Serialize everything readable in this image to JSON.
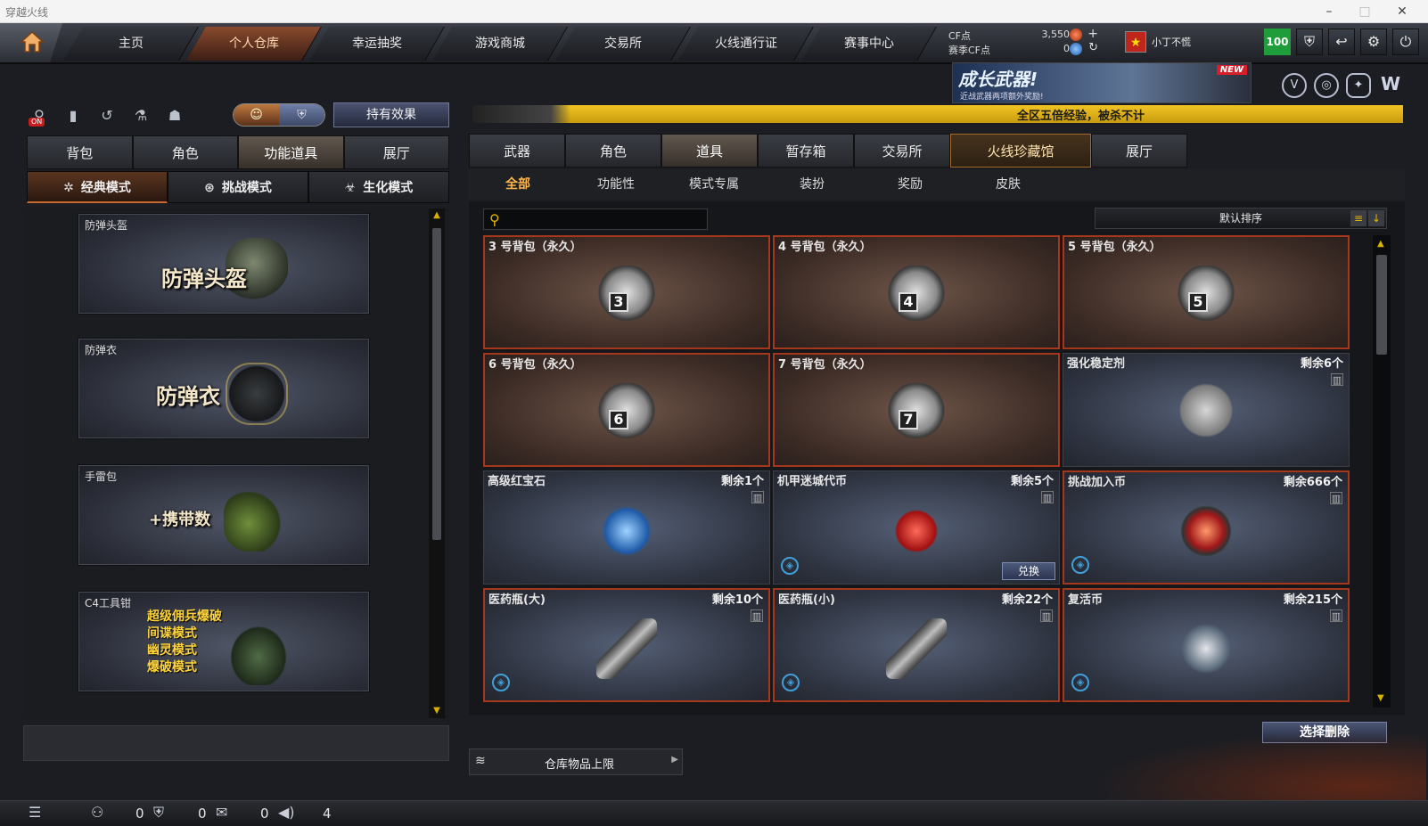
{
  "window": {
    "title": "穿越火线"
  },
  "nav": {
    "tabs": [
      {
        "label": "主页"
      },
      {
        "label": "个人仓库"
      },
      {
        "label": "幸运抽奖"
      },
      {
        "label": "游戏商城"
      },
      {
        "label": "交易所"
      },
      {
        "label": "火线通行证"
      },
      {
        "label": "赛事中心"
      }
    ],
    "active_tab": "个人仓库",
    "cf_label": "CF点",
    "cf_value": "3,550",
    "season_cf_label": "赛季CF点",
    "season_cf_value": "0",
    "plus_symbol": "+",
    "refresh_symbol": "↻",
    "username": "小丁不慌",
    "level": "100"
  },
  "banner": {
    "title": "成长武器!",
    "subtitle": "近战武器两项额外奖励!",
    "badge": "NEW"
  },
  "marquee": {
    "text": "全区五倍经验，被杀不计"
  },
  "left": {
    "toggle_on_label": "ON",
    "effect_button": "持有效果",
    "tabs": [
      "背包",
      "角色",
      "功能道具",
      "展厅"
    ],
    "active_tab": "功能道具",
    "modes": [
      "经典模式",
      "挑战模式",
      "生化模式"
    ],
    "active_mode": "经典模式",
    "items": [
      {
        "small": "防弹头盔",
        "big": "防弹头盔"
      },
      {
        "small": "防弹衣",
        "big": "防弹衣"
      },
      {
        "small": "手雷包",
        "big": "+携带数"
      },
      {
        "small": "C4工具钳",
        "lines": [
          "超级佣兵爆破",
          "间谍模式",
          "幽灵模式",
          "爆破模式"
        ]
      }
    ]
  },
  "right": {
    "tabs": [
      "武器",
      "角色",
      "道具",
      "暂存箱",
      "交易所",
      "火线珍藏馆",
      "展厅"
    ],
    "active_tab": "道具",
    "special_tab": "火线珍藏馆",
    "subtabs": [
      "全部",
      "功能性",
      "模式专属",
      "装扮",
      "奖励",
      "皮肤"
    ],
    "active_subtab": "全部",
    "search_placeholder": "",
    "sort_label": "默认排序",
    "items": [
      {
        "title": "3 号背包（永久）",
        "remain": "",
        "style": "brown",
        "bag": "3"
      },
      {
        "title": "4 号背包（永久）",
        "remain": "",
        "style": "brown",
        "bag": "4"
      },
      {
        "title": "5 号背包（永久）",
        "remain": "",
        "style": "brown",
        "bag": "5"
      },
      {
        "title": "6 号背包（永久）",
        "remain": "",
        "style": "brown",
        "bag": "6"
      },
      {
        "title": "7 号背包（永久）",
        "remain": "",
        "style": "brown",
        "bag": "7"
      },
      {
        "title": "强化稳定剂",
        "remain": "剩余6个",
        "style": "blue"
      },
      {
        "title": "高级红宝石",
        "remain": "剩余1个",
        "style": "blue"
      },
      {
        "title": "机甲迷城代币",
        "remain": "剩余5个",
        "style": "blue",
        "exchange": "兑换"
      },
      {
        "title": "挑战加入币",
        "remain": "剩余666个",
        "style": "blue-sel"
      },
      {
        "title": "医药瓶(大)",
        "remain": "剩余10个",
        "style": "blue-sel"
      },
      {
        "title": "医药瓶(小)",
        "remain": "剩余22个",
        "style": "blue-sel"
      },
      {
        "title": "复活币",
        "remain": "剩余215个",
        "style": "blue-sel"
      }
    ],
    "delete_button": "选择删除",
    "capacity_label": "仓库物品上限"
  },
  "status": {
    "friends": "0",
    "clan": "0",
    "chat": "0",
    "volume": "4"
  }
}
